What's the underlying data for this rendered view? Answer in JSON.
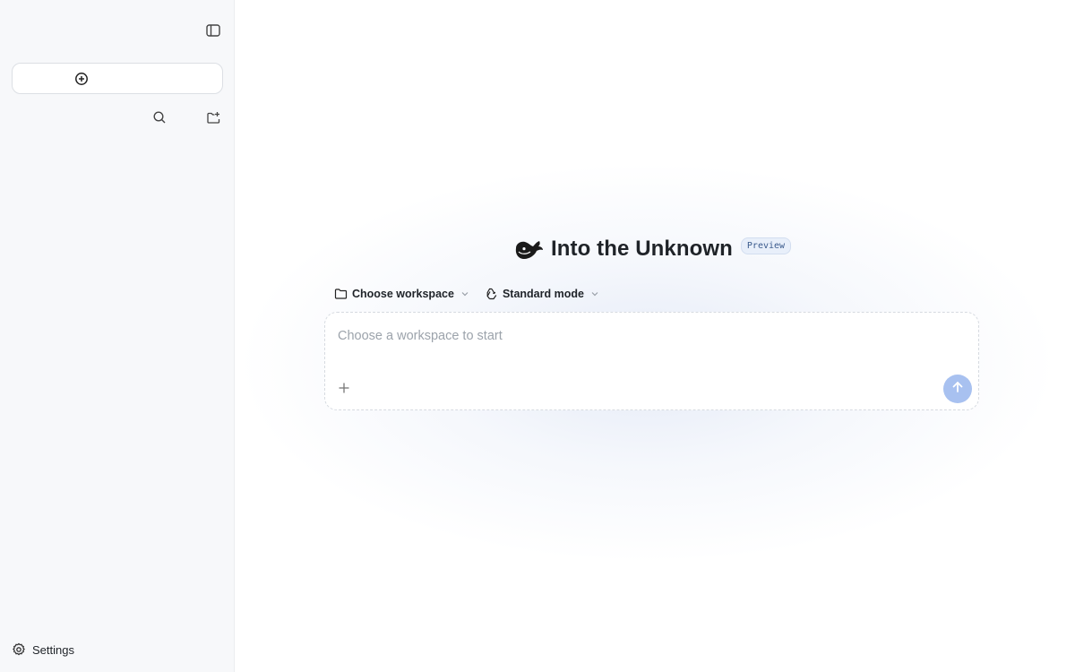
{
  "sidebar": {
    "toggle_icon": "sidebar-toggle-icon",
    "new_chat_icon": "plus-circle-icon",
    "search_icon": "search-icon",
    "new_folder_icon": "folder-plus-icon",
    "settings": {
      "label": "Settings",
      "icon": "gear-icon"
    }
  },
  "main": {
    "title": "Into the Unknown",
    "badge": "Preview",
    "logo_icon": "whale-logo-icon",
    "workspace_selector": {
      "label": "Choose workspace",
      "icon": "folder-icon"
    },
    "mode_selector": {
      "label": "Standard mode",
      "icon": "recycle-icon"
    },
    "composer": {
      "placeholder": "Choose a workspace to start",
      "value": "",
      "attach_icon": "plus-icon",
      "send_icon": "arrow-up-icon"
    }
  },
  "colors": {
    "sidebar_bg": "#f7f8fa",
    "send_button": "#a8c1f0",
    "badge_bg": "#e8effa"
  }
}
